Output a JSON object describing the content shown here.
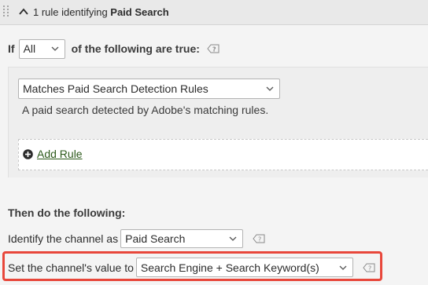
{
  "header": {
    "prefix": "1 rule identifying ",
    "name": "Paid Search"
  },
  "condition": {
    "if_label": "If",
    "match_select": "All",
    "suffix": "of the following are true:"
  },
  "rule": {
    "select_value": "Matches Paid Search Detection Rules",
    "description": "A paid search detected by Adobe's matching rules."
  },
  "add_rule_label": "Add Rule",
  "action": {
    "title": "Then do the following:",
    "identify_label": "Identify the channel as",
    "identify_value": "Paid Search",
    "set_label": "Set the channel's value to",
    "set_value": "Search Engine + Search Keyword(s)"
  },
  "colors": {
    "highlight": "#e8473b",
    "link": "#2d5a1b"
  },
  "icons": {
    "drag": "drag-handle-icon",
    "collapse": "chevron-up-icon",
    "help": "help-icon",
    "add": "plus-circle-icon"
  }
}
